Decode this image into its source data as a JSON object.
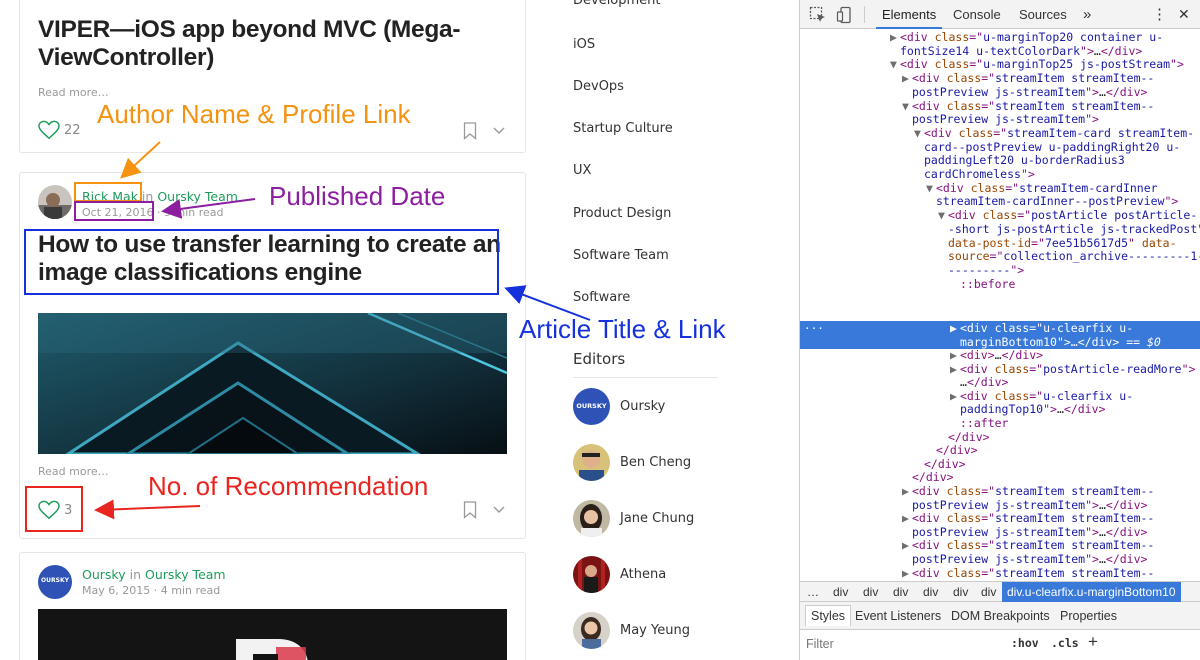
{
  "stream": {
    "card1": {
      "title_line1": "VIPER—iOS app beyond MVC (Mega-",
      "title_line2": "ViewController)",
      "read_more": "Read more…",
      "recommends": "22"
    },
    "card2": {
      "author": "Rick Mak",
      "in_word": "in",
      "publication": "Oursky Team",
      "date": "Oct 21, 2016",
      "read_time": "9 min read",
      "title_line1": "How to use transfer learning to create an",
      "title_line2": "image classifications engine",
      "read_more": "Read more…",
      "recommends": "3"
    },
    "card3": {
      "author": "Oursky",
      "in_word": "in",
      "publication": "Oursky Team",
      "date": "May 6, 2015",
      "read_time": "4 min read",
      "avatar_text": "OURSKY"
    }
  },
  "topics": [
    "Development",
    "iOS",
    "DevOps",
    "Startup Culture",
    "UX",
    "Product Design",
    "Software Team",
    "Software"
  ],
  "editors": {
    "heading": "Editors",
    "list": [
      {
        "name": "Oursky",
        "avatar_text": "OURSKY"
      },
      {
        "name": "Ben Cheng"
      },
      {
        "name": "Jane Chung"
      },
      {
        "name": "Athena"
      },
      {
        "name": "May Yeung"
      }
    ]
  },
  "annotations": {
    "author": "Author Name & Profile Link",
    "date": "Published Date",
    "title": "Article Title & Link",
    "recommend": "No. of Recommendation",
    "colors": {
      "author": "#f5920f",
      "date": "#8b1fa0",
      "title": "#1431dc",
      "recommend": "#e8251f"
    }
  },
  "devtools": {
    "tabs": [
      "Elements",
      "Console",
      "Sources"
    ],
    "more_tabs": "»",
    "menu": "⋮",
    "close": "✕",
    "dom_lines": [
      {
        "indent": 0,
        "arrow": "▶",
        "parts": [
          [
            "tag",
            "<div "
          ],
          [
            "attr",
            "class"
          ],
          [
            "tag",
            "=\""
          ],
          [
            "val",
            "u-marginTop20 container u-"
          ]
        ]
      },
      {
        "indent": 0,
        "arrow": "",
        "parts": [
          [
            "val",
            "fontSize14 u-textColorDark"
          ],
          [
            "tag",
            "\">"
          ],
          [
            "txt",
            "…"
          ],
          [
            "tag",
            "</div>"
          ]
        ]
      },
      {
        "indent": 0,
        "arrow": "▼",
        "parts": [
          [
            "tag",
            "<div "
          ],
          [
            "attr",
            "class"
          ],
          [
            "tag",
            "=\""
          ],
          [
            "val",
            "u-marginTop25 js-postStream"
          ],
          [
            "tag",
            "\">"
          ]
        ]
      },
      {
        "indent": 1,
        "arrow": "▶",
        "parts": [
          [
            "tag",
            "<div "
          ],
          [
            "attr",
            "class"
          ],
          [
            "tag",
            "=\""
          ],
          [
            "val",
            "streamItem streamItem--"
          ]
        ]
      },
      {
        "indent": 1,
        "arrow": "",
        "parts": [
          [
            "val",
            "postPreview js-streamItem"
          ],
          [
            "tag",
            "\">"
          ],
          [
            "txt",
            "…"
          ],
          [
            "tag",
            "</div>"
          ]
        ]
      },
      {
        "indent": 1,
        "arrow": "▼",
        "parts": [
          [
            "tag",
            "<div "
          ],
          [
            "attr",
            "class"
          ],
          [
            "tag",
            "=\""
          ],
          [
            "val",
            "streamItem streamItem--"
          ]
        ]
      },
      {
        "indent": 1,
        "arrow": "",
        "parts": [
          [
            "val",
            "postPreview js-streamItem"
          ],
          [
            "tag",
            "\">"
          ]
        ]
      },
      {
        "indent": 2,
        "arrow": "▼",
        "parts": [
          [
            "tag",
            "<div "
          ],
          [
            "attr",
            "class"
          ],
          [
            "tag",
            "=\""
          ],
          [
            "val",
            "streamItem-card streamItem-"
          ]
        ]
      },
      {
        "indent": 2,
        "arrow": "",
        "parts": [
          [
            "val",
            "card--postPreview u-paddingRight20 u-"
          ]
        ]
      },
      {
        "indent": 2,
        "arrow": "",
        "parts": [
          [
            "val",
            "paddingLeft20 u-borderRadius3"
          ]
        ]
      },
      {
        "indent": 2,
        "arrow": "",
        "parts": [
          [
            "val",
            "cardChromeless"
          ],
          [
            "tag",
            "\">"
          ]
        ]
      },
      {
        "indent": 3,
        "arrow": "▼",
        "parts": [
          [
            "tag",
            "<div "
          ],
          [
            "attr",
            "class"
          ],
          [
            "tag",
            "=\""
          ],
          [
            "val",
            "streamItem-cardInner"
          ]
        ]
      },
      {
        "indent": 3,
        "arrow": "",
        "parts": [
          [
            "val",
            "streamItem-cardInner--postPreview"
          ],
          [
            "tag",
            "\">"
          ]
        ]
      },
      {
        "indent": 4,
        "arrow": "▼",
        "parts": [
          [
            "tag",
            "<div "
          ],
          [
            "attr",
            "class"
          ],
          [
            "tag",
            "=\""
          ],
          [
            "val",
            "postArticle postArticle-"
          ]
        ]
      },
      {
        "indent": 4,
        "arrow": "",
        "parts": [
          [
            "val",
            "-short js-postArticle js-trackedPost"
          ],
          [
            "tag",
            "\""
          ]
        ]
      },
      {
        "indent": 4,
        "arrow": "",
        "parts": [
          [
            "attr",
            "data-post-id"
          ],
          [
            "tag",
            "=\""
          ],
          [
            "val",
            "7ee51b5617d5"
          ],
          [
            "tag",
            "\" "
          ],
          [
            "attr",
            "data-"
          ]
        ]
      },
      {
        "indent": 4,
        "arrow": "",
        "parts": [
          [
            "attr",
            "source"
          ],
          [
            "tag",
            "=\""
          ],
          [
            "val",
            "collection_archive---------1---"
          ]
        ]
      },
      {
        "indent": 4,
        "arrow": "",
        "parts": [
          [
            "val",
            "---------"
          ],
          [
            "tag",
            "\">"
          ]
        ]
      },
      {
        "indent": 5,
        "arrow": "",
        "parts": [
          [
            "pseudo",
            "::before"
          ]
        ]
      }
    ],
    "selected_lines": [
      {
        "indent": 5,
        "arrow": "▶",
        "parts": [
          [
            "tag",
            "<div "
          ],
          [
            "attr",
            "class"
          ],
          [
            "tag",
            "=\""
          ],
          [
            "val",
            "u-clearfix u-"
          ]
        ]
      },
      {
        "indent": 5,
        "arrow": "",
        "parts": [
          [
            "val",
            "marginBottom10"
          ],
          [
            "tag",
            "\">"
          ],
          [
            "txt",
            "…"
          ],
          [
            "tag",
            "</div>"
          ],
          [
            "dollar",
            " == $0"
          ]
        ]
      }
    ],
    "dom_lines_after": [
      {
        "indent": 5,
        "arrow": "▶",
        "parts": [
          [
            "tag",
            "<div>"
          ],
          [
            "txt",
            "…"
          ],
          [
            "tag",
            "</div>"
          ]
        ]
      },
      {
        "indent": 5,
        "arrow": "▶",
        "parts": [
          [
            "tag",
            "<div "
          ],
          [
            "attr",
            "class"
          ],
          [
            "tag",
            "=\""
          ],
          [
            "val",
            "postArticle-readMore"
          ],
          [
            "tag",
            "\">"
          ]
        ]
      },
      {
        "indent": 5,
        "arrow": "",
        "parts": [
          [
            "txt",
            "…"
          ],
          [
            "tag",
            "</div>"
          ]
        ]
      },
      {
        "indent": 5,
        "arrow": "▶",
        "parts": [
          [
            "tag",
            "<div "
          ],
          [
            "attr",
            "class"
          ],
          [
            "tag",
            "=\""
          ],
          [
            "val",
            "u-clearfix u-"
          ]
        ]
      },
      {
        "indent": 5,
        "arrow": "",
        "parts": [
          [
            "val",
            "paddingTop10"
          ],
          [
            "tag",
            "\">"
          ],
          [
            "txt",
            "…"
          ],
          [
            "tag",
            "</div>"
          ]
        ]
      },
      {
        "indent": 5,
        "arrow": "",
        "parts": [
          [
            "pseudo",
            "::after"
          ]
        ]
      },
      {
        "indent": 4,
        "arrow": "",
        "parts": [
          [
            "tag",
            "</div>"
          ]
        ]
      },
      {
        "indent": 3,
        "arrow": "",
        "parts": [
          [
            "tag",
            "</div>"
          ]
        ]
      },
      {
        "indent": 2,
        "arrow": "",
        "parts": [
          [
            "tag",
            "</div>"
          ]
        ]
      },
      {
        "indent": 1,
        "arrow": "",
        "parts": [
          [
            "tag",
            "</div>"
          ]
        ]
      },
      {
        "indent": 1,
        "arrow": "▶",
        "parts": [
          [
            "tag",
            "<div "
          ],
          [
            "attr",
            "class"
          ],
          [
            "tag",
            "=\""
          ],
          [
            "val",
            "streamItem streamItem--"
          ]
        ]
      },
      {
        "indent": 1,
        "arrow": "",
        "parts": [
          [
            "val",
            "postPreview js-streamItem"
          ],
          [
            "tag",
            "\">"
          ],
          [
            "txt",
            "…"
          ],
          [
            "tag",
            "</div>"
          ]
        ]
      },
      {
        "indent": 1,
        "arrow": "▶",
        "parts": [
          [
            "tag",
            "<div "
          ],
          [
            "attr",
            "class"
          ],
          [
            "tag",
            "=\""
          ],
          [
            "val",
            "streamItem streamItem--"
          ]
        ]
      },
      {
        "indent": 1,
        "arrow": "",
        "parts": [
          [
            "val",
            "postPreview js-streamItem"
          ],
          [
            "tag",
            "\">"
          ],
          [
            "txt",
            "…"
          ],
          [
            "tag",
            "</div>"
          ]
        ]
      },
      {
        "indent": 1,
        "arrow": "▶",
        "parts": [
          [
            "tag",
            "<div "
          ],
          [
            "attr",
            "class"
          ],
          [
            "tag",
            "=\""
          ],
          [
            "val",
            "streamItem streamItem--"
          ]
        ]
      },
      {
        "indent": 1,
        "arrow": "",
        "parts": [
          [
            "val",
            "postPreview js-streamItem"
          ],
          [
            "tag",
            "\">"
          ],
          [
            "txt",
            "…"
          ],
          [
            "tag",
            "</div>"
          ]
        ]
      },
      {
        "indent": 1,
        "arrow": "▶",
        "parts": [
          [
            "tag",
            "<div "
          ],
          [
            "attr",
            "class"
          ],
          [
            "tag",
            "=\""
          ],
          [
            "val",
            "streamItem streamItem--"
          ]
        ]
      },
      {
        "indent": 1,
        "arrow": "",
        "parts": [
          [
            "val",
            "postPreview js-streamItem"
          ],
          [
            "tag",
            "\">"
          ],
          [
            "txt",
            "…"
          ],
          [
            "tag",
            "</div>"
          ]
        ]
      },
      {
        "indent": 1,
        "arrow": "▶",
        "parts": [
          [
            "tag",
            "<div "
          ],
          [
            "attr",
            "class"
          ],
          [
            "tag",
            "=\""
          ],
          [
            "val",
            "streamItem streamItem--"
          ]
        ]
      }
    ],
    "breadcrumbs": [
      "…",
      "div",
      "div",
      "div",
      "div",
      "div",
      "div"
    ],
    "breadcrumb_active": "div.u-clearfix.u-marginBottom10",
    "style_tabs": [
      "Styles",
      "Event Listeners",
      "DOM Breakpoints",
      "Properties"
    ],
    "filter_placeholder": "Filter",
    "hov": ":hov",
    "cls": ".cls",
    "plus": "+"
  }
}
